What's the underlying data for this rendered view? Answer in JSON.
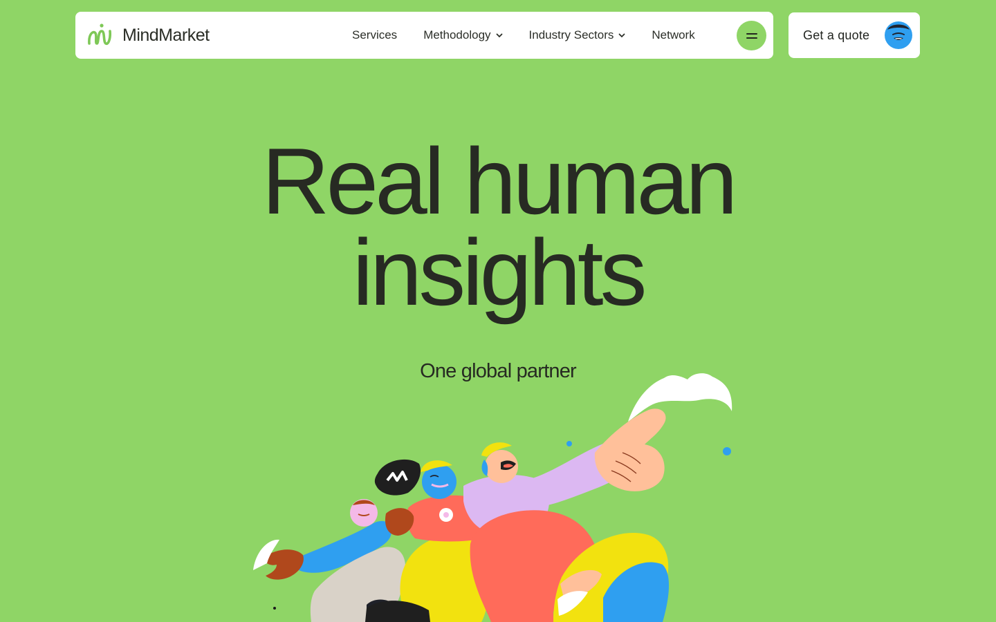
{
  "brand": {
    "name": "MindMarket",
    "accent_color": "#8fd566",
    "logo_icon": "mindmarket-swirl-logo-icon"
  },
  "nav": {
    "items": [
      {
        "label": "Services",
        "has_dropdown": false
      },
      {
        "label": "Methodology",
        "has_dropdown": true
      },
      {
        "label": "Industry Sectors",
        "has_dropdown": true
      },
      {
        "label": "Network",
        "has_dropdown": false
      }
    ],
    "menu_icon": "menu-icon"
  },
  "cta": {
    "label": "Get a quote",
    "avatar_icon": "smiling-face-avatar-icon"
  },
  "hero": {
    "title_line1": "Real human",
    "title_line2": "insights",
    "subtitle": "One global partner",
    "illustration": "group-of-people-illustration"
  }
}
